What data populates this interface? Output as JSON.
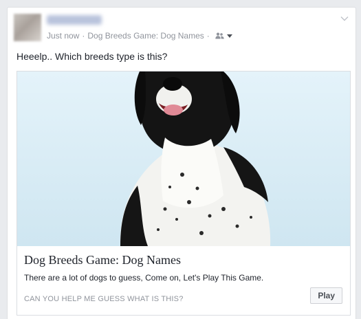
{
  "post": {
    "timestamp": "Just now",
    "app_link": "Dog Breeds Game: Dog Names",
    "message": "Heeelp.. Which breeds type is this?",
    "audience_icon": "friends-icon",
    "options_icon": "chevron-down-icon"
  },
  "attachment": {
    "title": "Dog Breeds Game: Dog Names",
    "description": "There are a lot of dogs to guess, Come on, Let's Play This Game.",
    "caption": "CAN YOU HELP ME GUESS WHAT IS THIS?",
    "button_label": "Play",
    "image_subject": "black-and-white-puppy"
  },
  "colors": {
    "page_background": "#e9ebee",
    "card_background": "#ffffff",
    "meta_text": "#90949c",
    "body_text": "#1d2129",
    "photo_background": "#dbeef7"
  }
}
